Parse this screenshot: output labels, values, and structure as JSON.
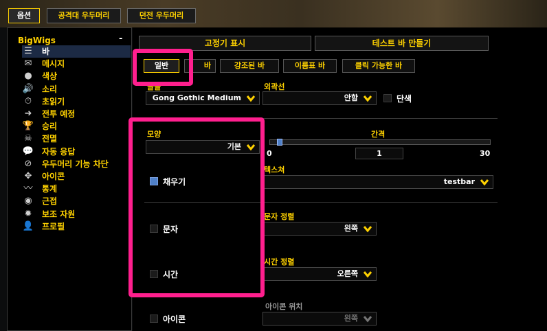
{
  "top_tabs": [
    {
      "label": "옵션",
      "active": true
    },
    {
      "label": "공격대 우두머리",
      "active": false
    },
    {
      "label": "던전 우두머리",
      "active": false
    }
  ],
  "sidebar": {
    "root_label": "BigWigs",
    "collapse_glyph": "-",
    "items": [
      {
        "label": "바",
        "icon": "bars-icon",
        "glyph": "☰",
        "selected": true
      },
      {
        "label": "메시지",
        "icon": "envelope-icon",
        "glyph": "✉",
        "selected": false
      },
      {
        "label": "색상",
        "icon": "color-dots-icon",
        "glyph": "●",
        "selected": false
      },
      {
        "label": "소리",
        "icon": "speaker-icon",
        "glyph": "🔊",
        "selected": false
      },
      {
        "label": "초읽기",
        "icon": "stopwatch-icon",
        "glyph": "⏱",
        "selected": false
      },
      {
        "label": "전투 예정",
        "icon": "arrows-icon",
        "glyph": "➜",
        "selected": false
      },
      {
        "label": "승리",
        "icon": "trophy-icon",
        "glyph": "🏆",
        "selected": false
      },
      {
        "label": "전멸",
        "icon": "skull-icon",
        "glyph": "☠",
        "selected": false
      },
      {
        "label": "자동 응답",
        "icon": "chat-bubble-icon",
        "glyph": "💬",
        "selected": false
      },
      {
        "label": "우두머리 기능 차단",
        "icon": "block-icon",
        "glyph": "⊘",
        "selected": false
      },
      {
        "label": "아이콘",
        "icon": "target-icon",
        "glyph": "✥",
        "selected": false
      },
      {
        "label": "통계",
        "icon": "stats-icon",
        "glyph": "〰",
        "selected": false
      },
      {
        "label": "근접",
        "icon": "radar-icon",
        "glyph": "◉",
        "selected": false
      },
      {
        "label": "보조 자원",
        "icon": "sun-icon",
        "glyph": "✹",
        "selected": false
      },
      {
        "label": "프로필",
        "icon": "person-icon",
        "glyph": "👤",
        "selected": false
      }
    ]
  },
  "main": {
    "anchor_button": "고정기 표시",
    "test_bar_button": "테스트 바 만들기",
    "subtabs": [
      {
        "label": "일반",
        "active": true
      },
      {
        "label": "바",
        "active": false
      },
      {
        "label": "강조된 바",
        "active": false
      },
      {
        "label": "이름표 바",
        "active": false
      },
      {
        "label": "클릭 가능한 바",
        "active": false
      }
    ],
    "font_label": "글꼴",
    "font_value": "Gong Gothic Medium",
    "outline_label": "외곽선",
    "outline_value": "안함",
    "mono_label": "단색",
    "mono_checked": false,
    "style_label": "모양",
    "style_value": "기본",
    "spacing_label": "간격",
    "spacing_min": "0",
    "spacing_value": "1",
    "spacing_max": "30",
    "spacing_fraction": 0.033,
    "texture_label": "텍스쳐",
    "texture_value": "testbar",
    "fill_label": "채우기",
    "fill_checked": true,
    "text_label": "문자",
    "text_checked": false,
    "text_align_label": "문자 정렬",
    "text_align_value": "왼쪽",
    "time_label": "시간",
    "time_checked": false,
    "time_align_label": "시간 정렬",
    "time_align_value": "오른쪽",
    "icon_label": "아이콘",
    "icon_checked": false,
    "icon_pos_label": "아이콘 위치",
    "icon_pos_value": "왼쪽"
  },
  "colors": {
    "accent_yellow": "#ffd200",
    "highlight_pink": "#ff1f8e",
    "checkbox_blue": "#4f80c8"
  }
}
